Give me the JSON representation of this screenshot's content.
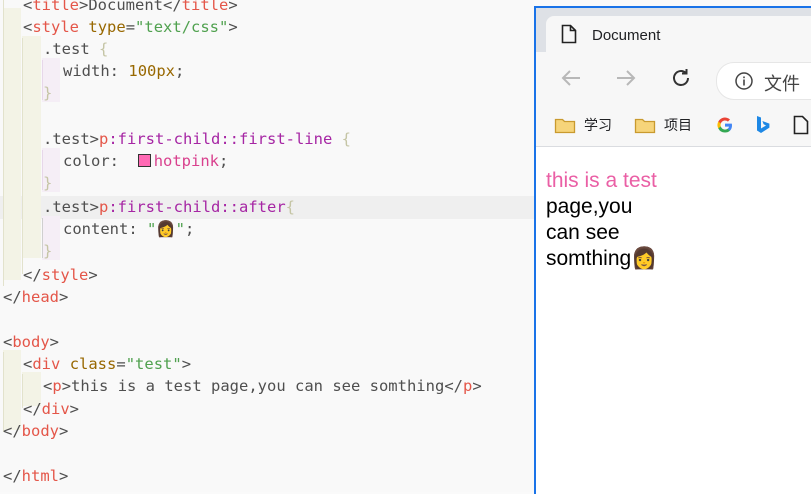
{
  "editor": {
    "lines": {
      "l0": {
        "lt1": "<",
        "t1": "title",
        "mid": ">Document</",
        "t2": "title",
        "gt": ">"
      },
      "l1": {
        "lt": "<",
        "tag": "style",
        "attr": "type",
        "eq": "=",
        "val": "\"text/css\"",
        "gt": ">"
      },
      "l2": {
        "sel": ".test",
        "brace": "{"
      },
      "l3": {
        "prop": "width",
        "colon": ":",
        "num": "100px",
        "semi": ";"
      },
      "l4": {
        "brace": "}"
      },
      "l6": {
        "sel": ".test>",
        "tag": "p",
        "pseudo": ":first-child::first-line",
        "brace": "{"
      },
      "l7": {
        "prop": "color",
        "colon": ":",
        "val": "hotpink",
        "semi": ";"
      },
      "l8": {
        "brace": "}"
      },
      "l9": {
        "sel": ".test>",
        "tag": "p",
        "pseudo": ":first-child::after",
        "brace": "{"
      },
      "l10": {
        "prop": "content",
        "colon": ":",
        "val": "\"👩\"",
        "semi": ";"
      },
      "l11": {
        "brace": "}"
      },
      "l12": {
        "open": "</",
        "tag": "style",
        "gt": ">"
      },
      "l13": {
        "open": "</",
        "tag": "head",
        "gt": ">"
      },
      "l15": {
        "lt": "<",
        "tag": "body",
        "gt": ">"
      },
      "l16": {
        "lt": "<",
        "tag": "div",
        "attr": "class",
        "eq": "=",
        "val": "\"test\"",
        "gt": ">"
      },
      "l17": {
        "lt": "<",
        "tag": "p",
        "gt": ">",
        "text": "this is a test page,you can see somthing",
        "close": "</",
        "tag2": "p",
        "gt2": ">"
      },
      "l18": {
        "open": "</",
        "tag": "div",
        "gt": ">"
      },
      "l19": {
        "open": "</",
        "tag": "body",
        "gt": ">"
      },
      "l21": {
        "open": "</",
        "tag": "html",
        "gt": ">"
      }
    },
    "swatch_color": "#ff69b4"
  },
  "browser": {
    "tab_title": "Document",
    "address_text": "文件",
    "bookmarks": [
      "学习",
      "项目"
    ],
    "page_lines": {
      "first": "this is a test",
      "l2": "page,you",
      "l3": "can see",
      "l4": "somthing",
      "after": "👩"
    },
    "first_line_color": "#ff69b4",
    "accent": "#1a73e8"
  }
}
